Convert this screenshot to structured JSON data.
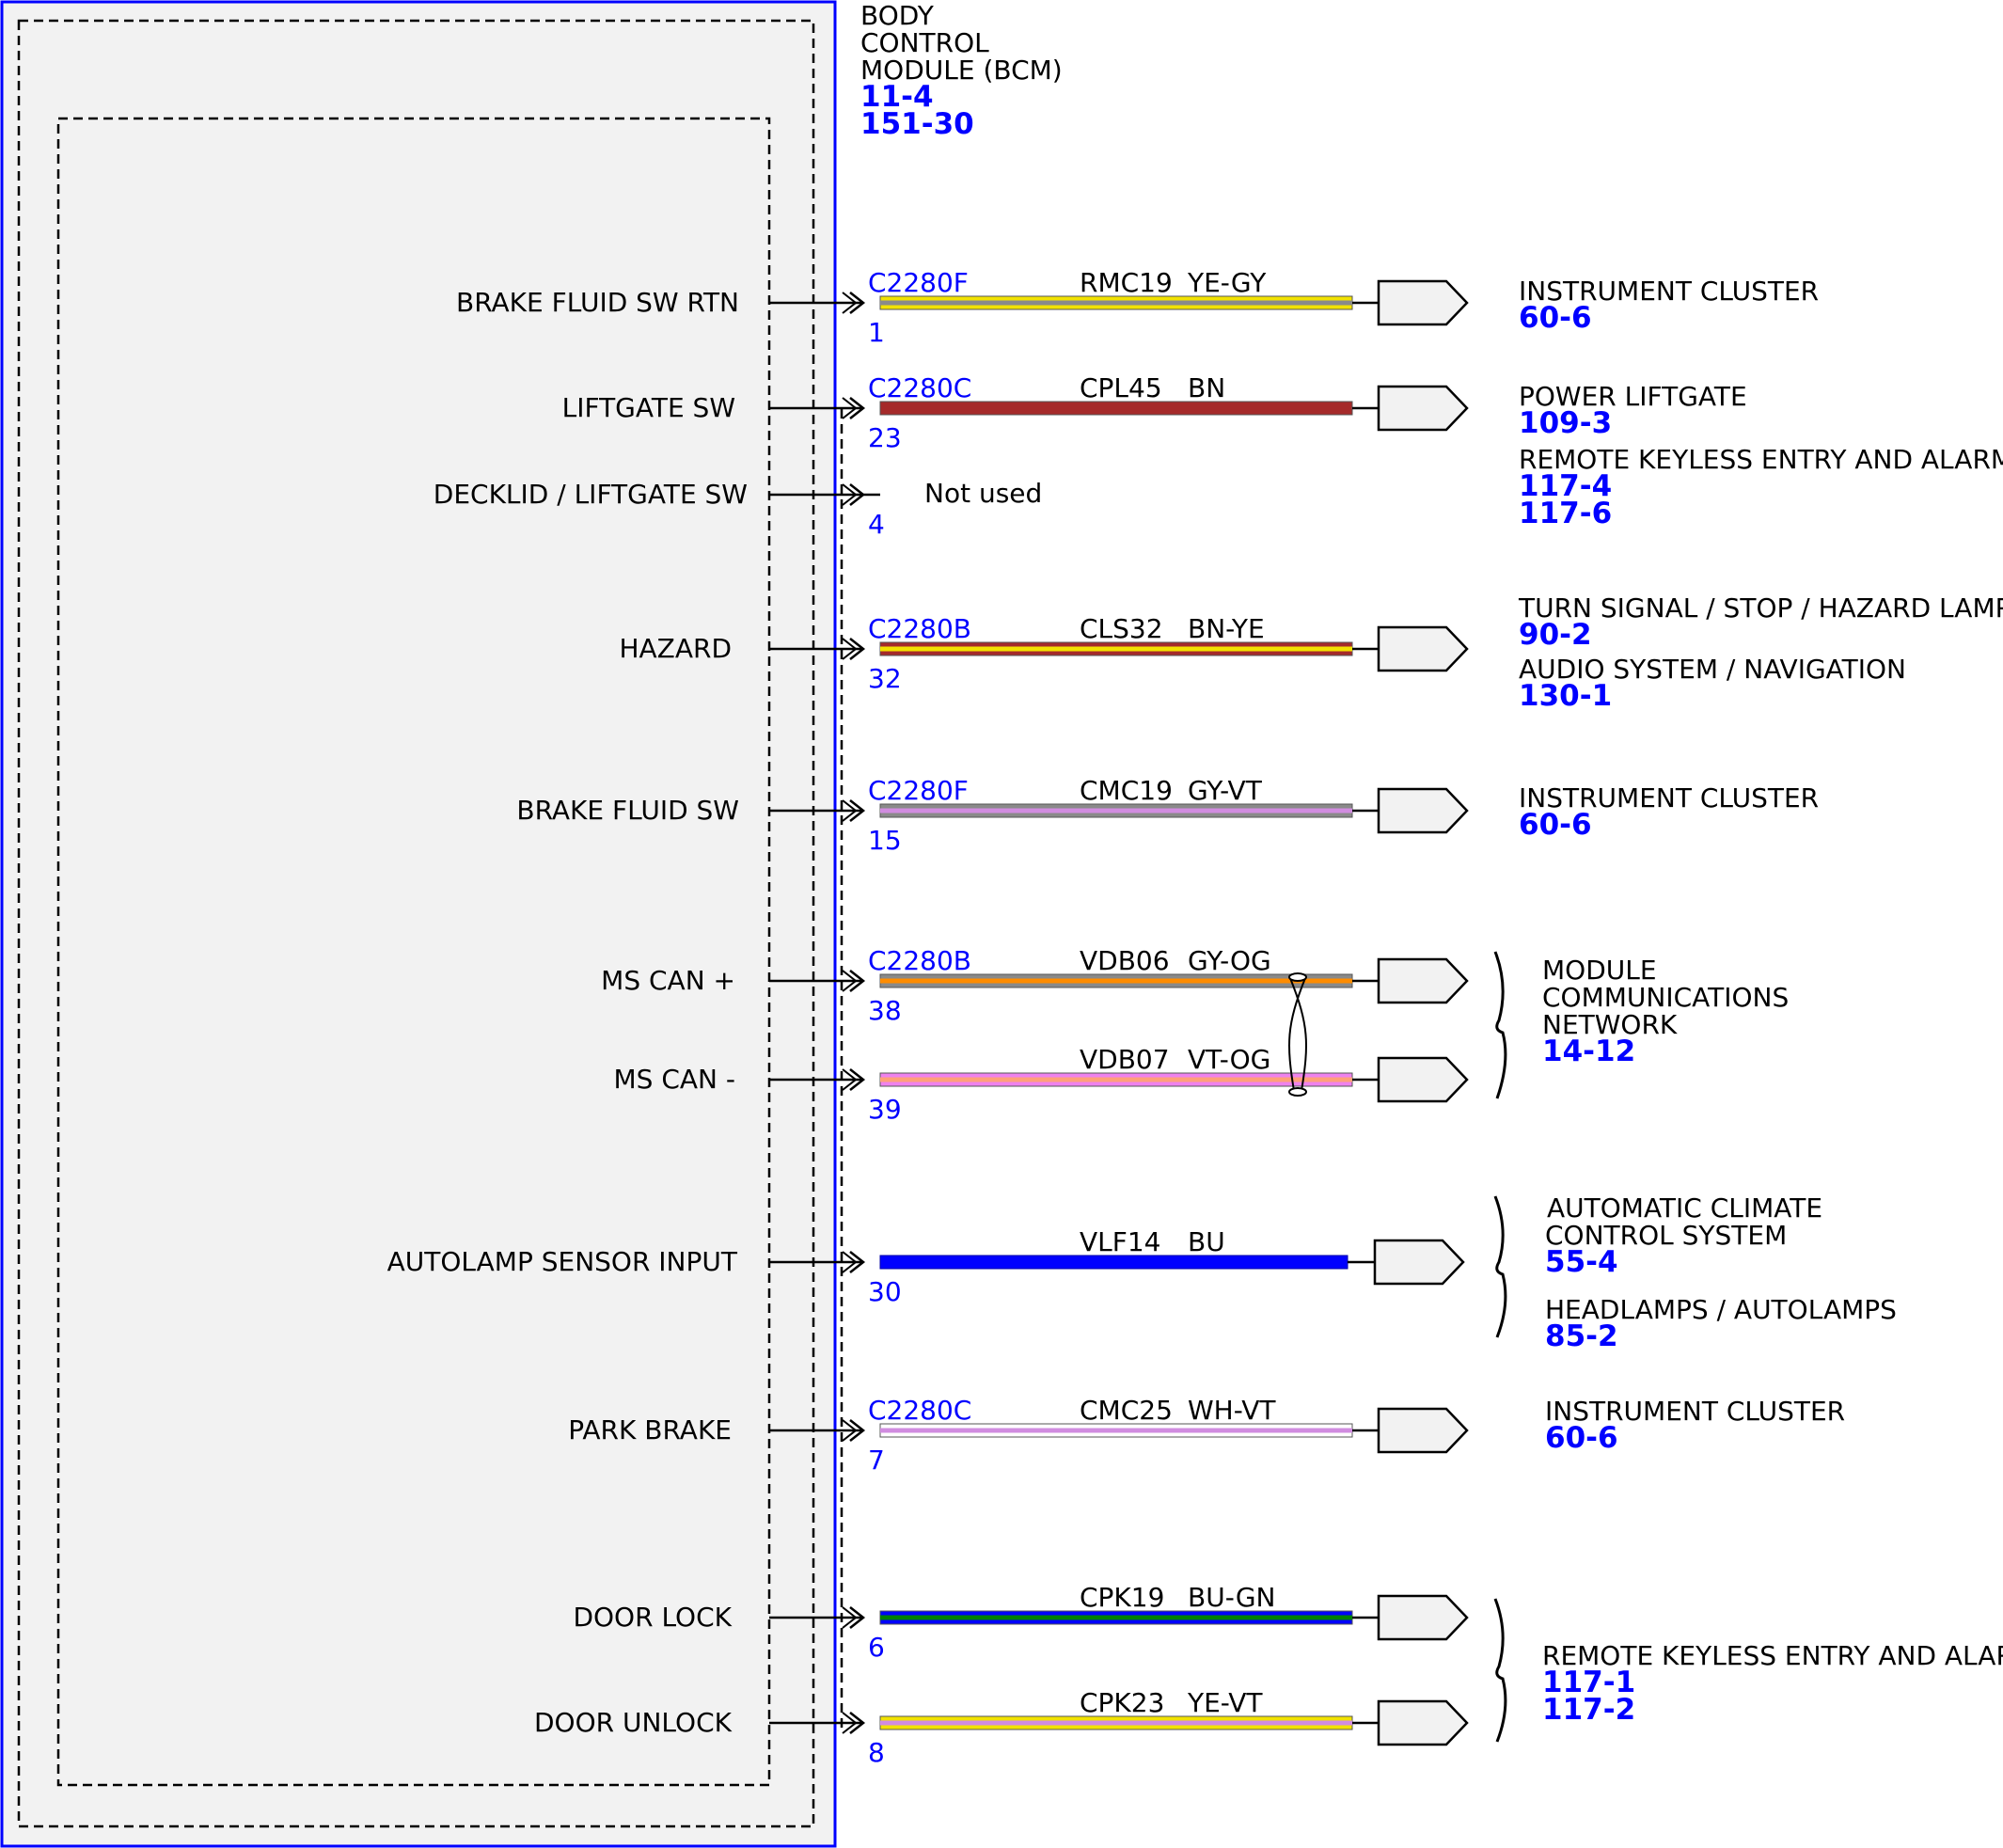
{
  "module": {
    "title_lines": [
      "BODY",
      "CONTROL",
      "MODULE (BCM)"
    ],
    "refs": [
      "11-4",
      "151-30"
    ]
  },
  "not_used_text": "Not used",
  "circuits": [
    {
      "function": "BRAKE FLUID SW RTN",
      "connector": "C2280F",
      "pin": "1",
      "circuit": "RMC19",
      "color_code": "YE-GY",
      "wire_colors": [
        "#f2e200",
        "#8a8a8a"
      ]
    },
    {
      "function": "LIFTGATE SW",
      "connector": "C2280C",
      "pin": "23",
      "circuit": "CPL45",
      "color_code": "BN",
      "wire_colors": [
        "#a52a2a"
      ]
    },
    {
      "function": "DECKLID / LIFTGATE SW",
      "connector": "",
      "pin": "4",
      "circuit": "",
      "color_code": "",
      "wire_colors": []
    },
    {
      "function": "HAZARD",
      "connector": "C2280B",
      "pin": "32",
      "circuit": "CLS32",
      "color_code": "BN-YE",
      "wire_colors": [
        "#a52a2a",
        "#f2e200"
      ]
    },
    {
      "function": "BRAKE FLUID SW",
      "connector": "C2280F",
      "pin": "15",
      "circuit": "CMC19",
      "color_code": "GY-VT",
      "wire_colors": [
        "#8a8a8a",
        "#d18ce0"
      ]
    },
    {
      "function": "MS CAN +",
      "connector": "C2280B",
      "pin": "38",
      "circuit": "VDB06",
      "color_code": "GY-OG",
      "wire_colors": [
        "#8a8a8a",
        "#ff8c00"
      ]
    },
    {
      "function": "MS CAN -",
      "connector": "",
      "pin": "39",
      "circuit": "VDB07",
      "color_code": "VT-OG",
      "wire_colors": [
        "#ee82ee",
        "#ffa07a"
      ]
    },
    {
      "function": "AUTOLAMP SENSOR INPUT",
      "connector": "",
      "pin": "30",
      "circuit": "VLF14",
      "color_code": "BU",
      "wire_colors": [
        "#0000ff"
      ]
    },
    {
      "function": "PARK BRAKE",
      "connector": "C2280C",
      "pin": "7",
      "circuit": "CMC25",
      "color_code": "WH-VT",
      "wire_colors": [
        "#ffffff",
        "#d18ce0"
      ]
    },
    {
      "function": "DOOR LOCK",
      "connector": "",
      "pin": "6",
      "circuit": "CPK19",
      "color_code": "BU-GN",
      "wire_colors": [
        "#0000ff",
        "#008000"
      ]
    },
    {
      "function": "DOOR UNLOCK",
      "connector": "",
      "pin": "8",
      "circuit": "CPK23",
      "color_code": "YE-VT",
      "wire_colors": [
        "#f2e200",
        "#d18ce0"
      ]
    }
  ],
  "destinations": [
    {
      "lines": [
        "INSTRUMENT CLUSTER"
      ],
      "refs": [
        "60-6"
      ]
    },
    {
      "lines": [
        "POWER LIFTGATE"
      ],
      "refs": [
        "109-3"
      ]
    },
    {
      "lines": [
        "REMOTE KEYLESS ENTRY AND ALARM"
      ],
      "refs": [
        "117-4",
        "117-6"
      ]
    },
    {
      "lines": [
        "TURN SIGNAL / STOP / HAZARD LAMPS"
      ],
      "refs": [
        "90-2"
      ]
    },
    {
      "lines": [
        "AUDIO SYSTEM / NAVIGATION"
      ],
      "refs": [
        "130-1"
      ]
    },
    {
      "lines": [
        "INSTRUMENT CLUSTER"
      ],
      "refs": [
        "60-6"
      ]
    },
    {
      "lines": [
        "MODULE",
        "COMMUNICATIONS",
        "NETWORK"
      ],
      "refs": [
        "14-12"
      ]
    },
    {
      "lines": [
        "AUTOMATIC CLIMATE",
        "CONTROL SYSTEM"
      ],
      "refs": [
        "55-4"
      ]
    },
    {
      "lines": [
        "HEADLAMPS / AUTOLAMPS"
      ],
      "refs": [
        "85-2"
      ]
    },
    {
      "lines": [
        "INSTRUMENT CLUSTER"
      ],
      "refs": [
        "60-6"
      ]
    },
    {
      "lines": [
        "REMOTE KEYLESS ENTRY AND ALARM"
      ],
      "refs": [
        "117-1",
        "117-2"
      ]
    }
  ],
  "colors": {
    "module_border": "#0000ff",
    "module_fill": "#f2f2f2",
    "reference_text": "#0000ff",
    "connector_fill": "#f2f2f2"
  }
}
